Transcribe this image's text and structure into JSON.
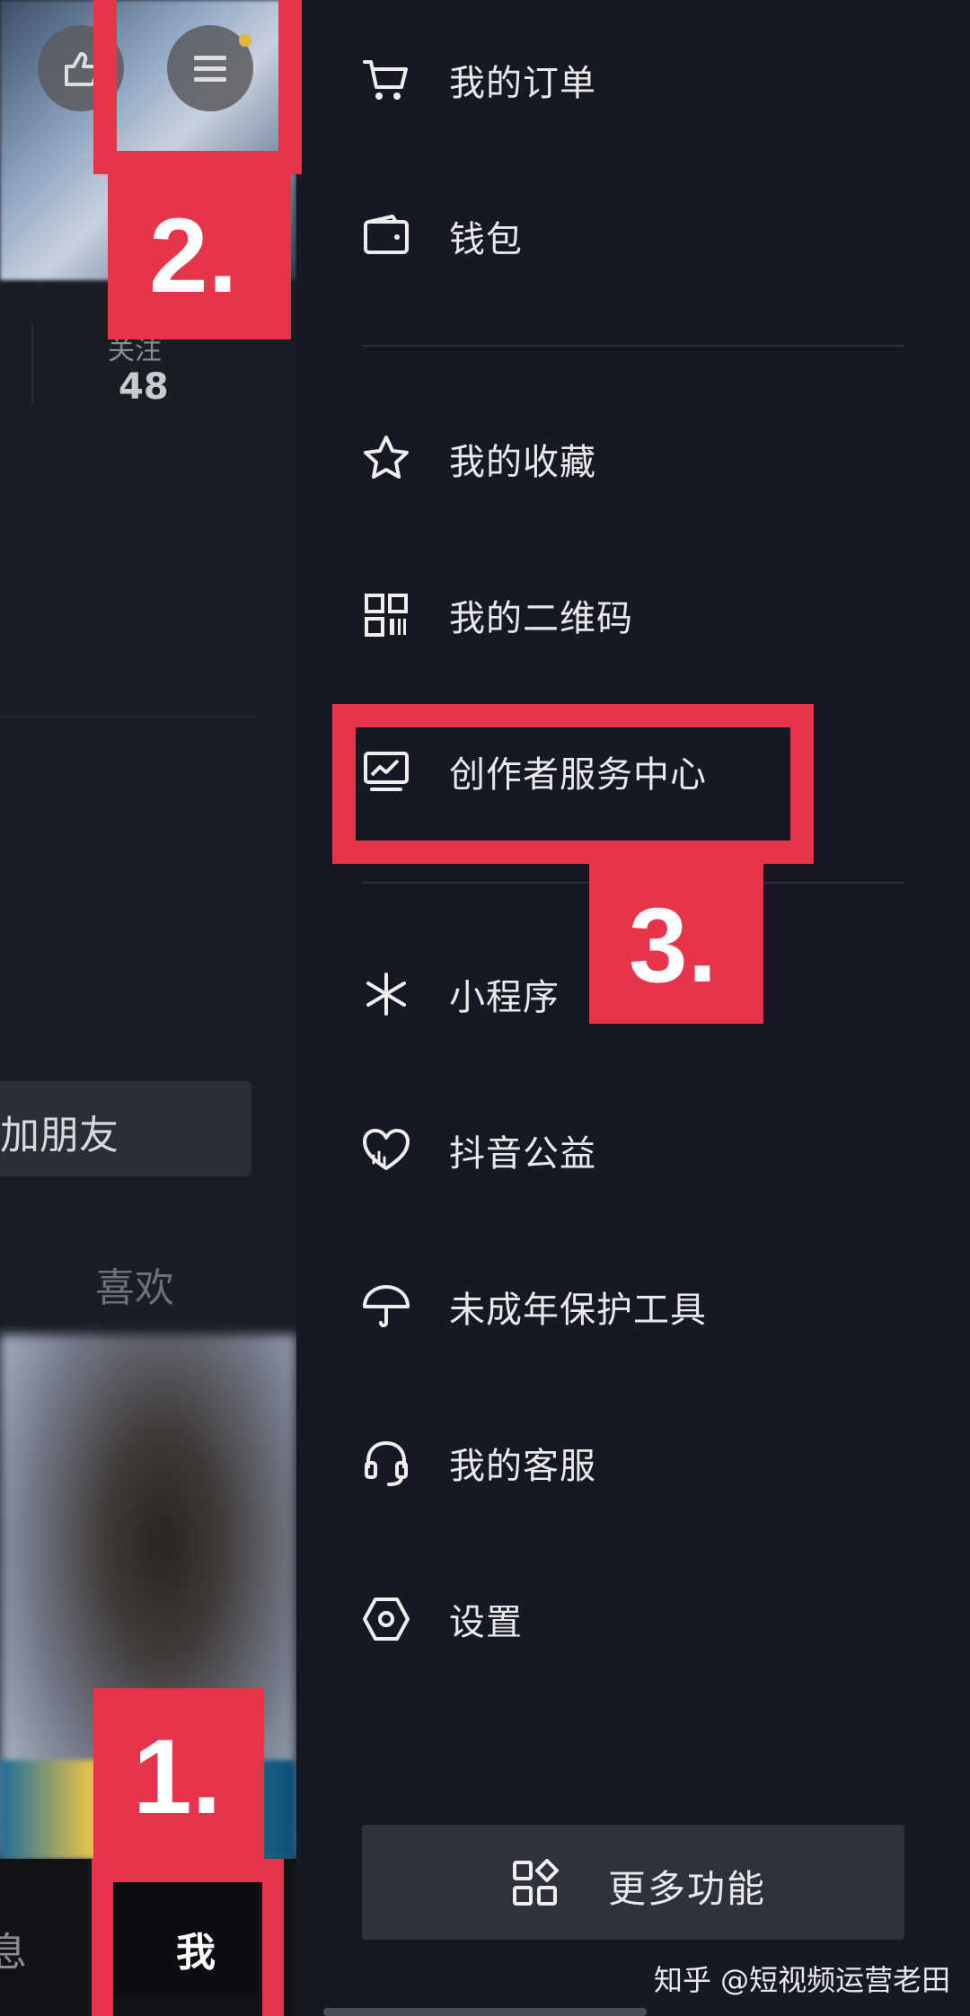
{
  "background_page": {
    "follow_label": "关注",
    "follow_count": "48",
    "add_friend": "加朋友",
    "likes_tab": "喜欢",
    "bottom_nav": {
      "messages_partial": "息",
      "me": "我"
    }
  },
  "annotations": {
    "step1": "1.",
    "step2": "2.",
    "step3": "3."
  },
  "drawer": {
    "items": [
      {
        "label": "我的订单",
        "icon": "cart-icon"
      },
      {
        "label": "钱包",
        "icon": "wallet-icon"
      },
      {
        "label": "我的收藏",
        "icon": "star-icon"
      },
      {
        "label": "我的二维码",
        "icon": "qr-code-icon"
      },
      {
        "label": "创作者服务中心",
        "icon": "creator-chart-icon"
      },
      {
        "label": "小程序",
        "icon": "mini-program-icon"
      },
      {
        "label": "抖音公益",
        "icon": "charity-heart-icon"
      },
      {
        "label": "未成年保护工具",
        "icon": "umbrella-icon"
      },
      {
        "label": "我的客服",
        "icon": "headset-icon"
      },
      {
        "label": "设置",
        "icon": "settings-hexagon-icon"
      }
    ],
    "more_button": "更多功能"
  },
  "watermark": "知乎 @短视频运营老田",
  "colors": {
    "annotation_red": "#e8344a",
    "drawer_bg": "#161823",
    "notification_dot": "#e8b339"
  }
}
